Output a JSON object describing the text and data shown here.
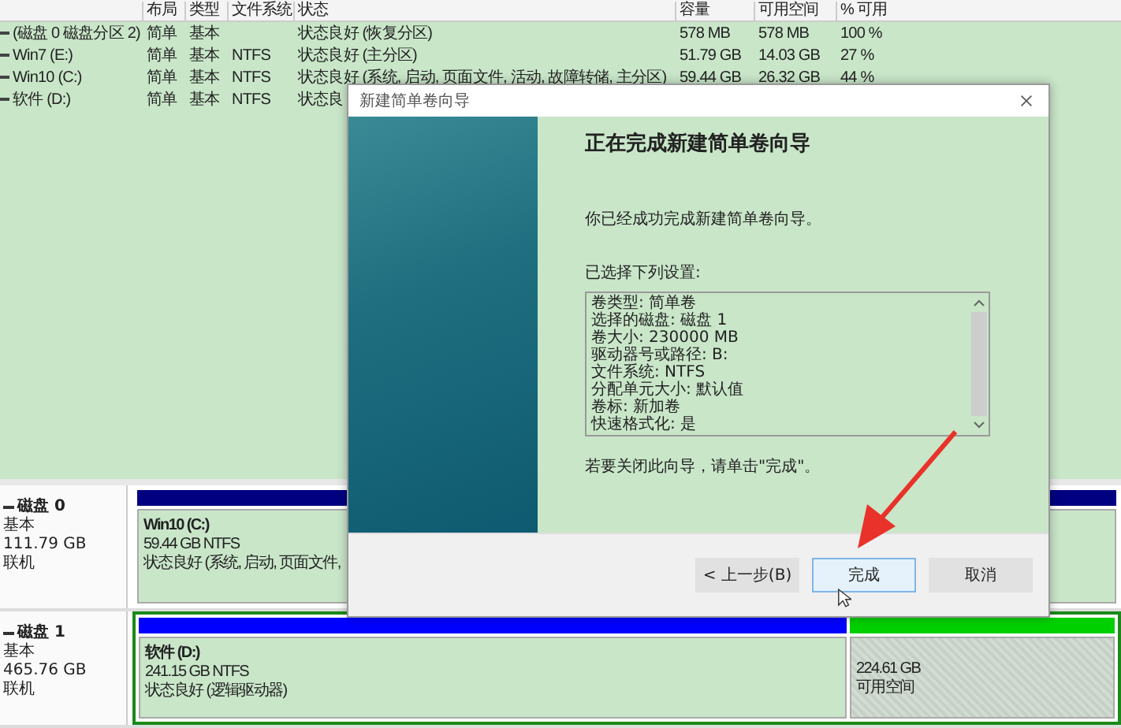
{
  "volume_table": {
    "columns": [
      "布局",
      "类型",
      "文件系统",
      "状态",
      "容量",
      "可用空间",
      "% 可用"
    ],
    "rows": [
      {
        "name": "(磁盘 0 磁盘分区 2)",
        "layout": "简单",
        "type": "基本",
        "status": "状态良好 (恢复分区)",
        "capacity": "578 MB",
        "free": "578 MB",
        "percent": "100 %"
      },
      {
        "name": "Win7 (E:)",
        "layout": "简单",
        "type": "基本",
        "fs": "NTFS",
        "status": "状态良好 (主分区)",
        "capacity": "51.79 GB",
        "free": "14.03 GB",
        "percent": "27 %"
      },
      {
        "name": "Win10 (C:)",
        "layout": "简单",
        "type": "基本",
        "fs": "NTFS",
        "status": "状态良好 (系统, 启动, 页面文件, 活动, 故障转储, 主分区)",
        "capacity": "59.44 GB",
        "free": "26.32 GB",
        "percent": "44 %"
      },
      {
        "name": "软件 (D:)",
        "layout": "简单",
        "type": "基本",
        "fs": "NTFS",
        "status": "状态良"
      }
    ]
  },
  "disks": [
    {
      "name": "磁盘 0",
      "type": "基本",
      "size": "111.79 GB",
      "status": "联机",
      "partitions": [
        {
          "kind": "volume",
          "color": "#000080",
          "name": "Win10  (C:)",
          "detail": "59.44 GB NTFS",
          "status": "状态良好 (系统, 启动, 页面文件,"
        }
      ]
    },
    {
      "name": "磁盘 1",
      "type": "基本",
      "size": "465.76 GB",
      "status": "联机",
      "partitions": [
        {
          "kind": "volume",
          "color": "#0000ff",
          "name": "软件  (D:)",
          "detail": "241.15 GB NTFS",
          "status": "状态良好 (逻辑驱动器)"
        },
        {
          "kind": "free",
          "color": "#00d000",
          "detail": "224.61 GB",
          "status": "可用空间"
        }
      ]
    }
  ],
  "wizard": {
    "title": "新建简单卷向导",
    "heading": "正在完成新建简单卷向导",
    "message": "你已经成功完成新建简单卷向导。",
    "settings_label": "已选择下列设置:",
    "settings": [
      "卷类型: 简单卷",
      "选择的磁盘: 磁盘 1",
      "卷大小: 230000 MB",
      "驱动器号或路径: B:",
      "文件系统: NTFS",
      "分配单元大小: 默认值",
      "卷标: 新加卷",
      "快速格式化: 是"
    ],
    "closing_note": "若要关闭此向导，请单击\"完成\"。",
    "buttons": [
      {
        "label": "< 上一步(B)",
        "default": false
      },
      {
        "label": "完成",
        "default": true
      },
      {
        "label": "取消",
        "default": false
      }
    ]
  }
}
